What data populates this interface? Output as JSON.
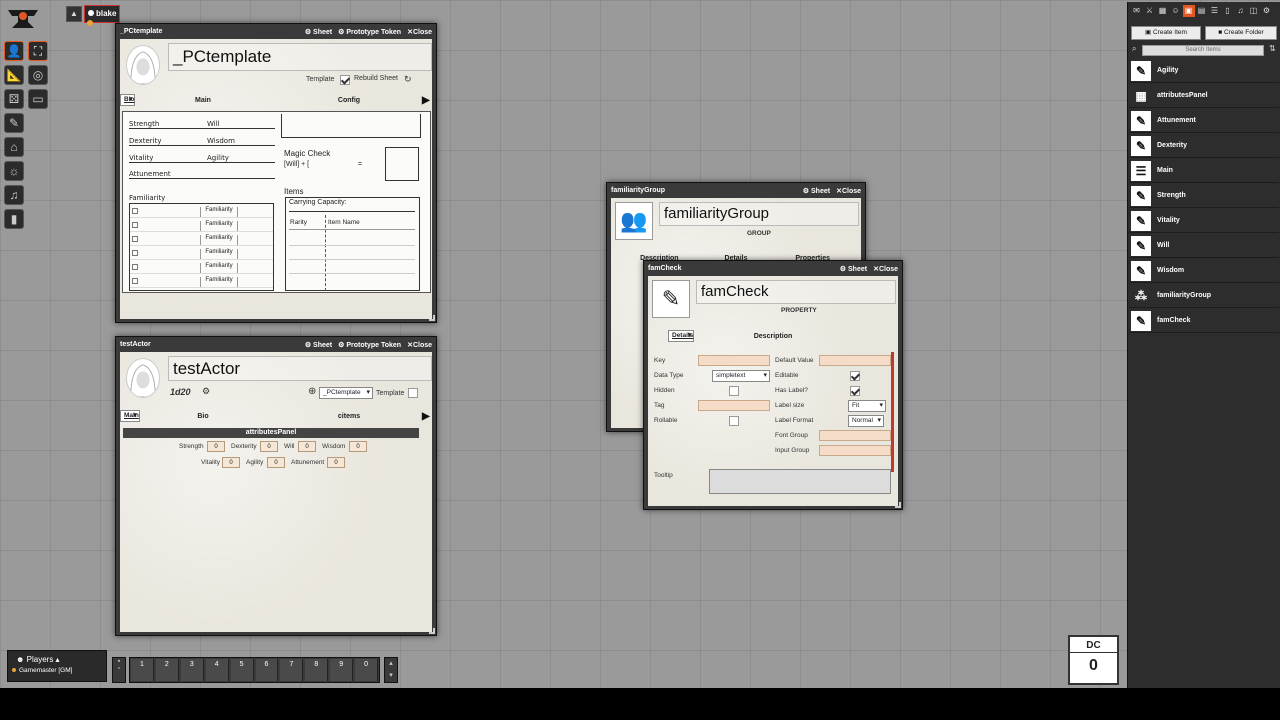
{
  "scene": {
    "tab_label": "blake",
    "toggle_icon": "caret-up"
  },
  "controls": [
    "token-icon",
    "fullscreen-icon",
    "ruler-icon",
    "target-icon",
    "dice-icon",
    "tape-icon",
    "pencil-icon",
    "temple-icon",
    "lightbulb-icon",
    "music-icon",
    "bookmark-icon"
  ],
  "windows": {
    "pctemplate": {
      "title": "_PCtemplate",
      "actions": [
        "Sheet",
        "Prototype Token",
        "Close"
      ],
      "name": "_PCtemplate",
      "template_label": "Template",
      "rebuild_label": "Rebuild Sheet",
      "tabs": [
        "Bio",
        "Main",
        "Config"
      ],
      "attrs": [
        "Strength",
        "Will",
        "Dexterity",
        "Wisdom",
        "Vitality",
        "Agility",
        "Attunement"
      ],
      "magic_check_title": "Magic Check",
      "magic_check_formula": "[Will] + [",
      "magic_check_eq": "=",
      "familiarity_title": "Familiarity",
      "familiarity_rows": [
        "Familiarity",
        "Familiarity",
        "Familiarity",
        "Familiarity",
        "Familiarity",
        "Familiarity"
      ],
      "items_title": "Items",
      "carrying_capacity": "Carrying Capacity:",
      "col_rarity": "Rarity",
      "col_item_name": "Item Name"
    },
    "testactor": {
      "title": "testActor",
      "actions": [
        "Sheet",
        "Prototype Token",
        "Close"
      ],
      "name": "testActor",
      "dice": "1d20",
      "template_select": "_PCtemplate",
      "template_label": "Template",
      "tabs": [
        "Bio",
        "Main",
        "citems"
      ],
      "panel_title": "attributesPanel",
      "row1": [
        {
          "label": "Strength",
          "value": "0"
        },
        {
          "label": "Dexterity",
          "value": "0"
        },
        {
          "label": "Will",
          "value": "0"
        },
        {
          "label": "Wisdom",
          "value": "0"
        }
      ],
      "row2": [
        {
          "label": "Vitality",
          "value": "0"
        },
        {
          "label": "Agility",
          "value": "0"
        },
        {
          "label": "Attunement",
          "value": "0"
        }
      ]
    },
    "famgroup": {
      "title": "familiarityGroup",
      "actions": [
        "Sheet",
        "Close"
      ],
      "name": "familiarityGroup",
      "kind": "GROUP",
      "tabs": [
        "Description",
        "Details",
        "Properties"
      ]
    },
    "famcheck": {
      "title": "famCheck",
      "actions": [
        "Sheet",
        "Close"
      ],
      "name": "famCheck",
      "kind": "PROPERTY",
      "tabs": [
        "Description",
        "Details"
      ],
      "fields": {
        "key": "Key",
        "data_type": "Data Type",
        "data_type_value": "simpletext",
        "hidden": "Hidden",
        "tag": "Tag",
        "rollable": "Rollable",
        "default_value": "Default Value",
        "editable": "Editable",
        "has_label": "Has Label?",
        "label_size": "Label size",
        "label_size_value": "Fit",
        "label_format": "Label Format",
        "label_format_value": "Normal",
        "font_group": "Font Group",
        "input_group": "Input Group",
        "tooltip": "Tooltip"
      }
    }
  },
  "sidebar": {
    "create_item": "Create Item",
    "create_folder": "Create Folder",
    "search_placeholder": "Search Items",
    "items": [
      {
        "label": "Agility",
        "icon": "edit-icon"
      },
      {
        "label": "attributesPanel",
        "icon": "grid-icon"
      },
      {
        "label": "Attunement",
        "icon": "edit-icon"
      },
      {
        "label": "Dexterity",
        "icon": "edit-icon"
      },
      {
        "label": "Main",
        "icon": "list-icon"
      },
      {
        "label": "Strength",
        "icon": "edit-icon"
      },
      {
        "label": "Vitality",
        "icon": "edit-icon"
      },
      {
        "label": "Will",
        "icon": "edit-icon"
      },
      {
        "label": "Wisdom",
        "icon": "edit-icon"
      },
      {
        "label": "familiarityGroup",
        "icon": "group-icon"
      },
      {
        "label": "famCheck",
        "icon": "edit-icon"
      }
    ]
  },
  "players": {
    "title": "Players",
    "entry": "Gamemaster [GM]"
  },
  "hotbar": {
    "slots": [
      "1",
      "2",
      "3",
      "4",
      "5",
      "6",
      "7",
      "8",
      "9",
      "0"
    ]
  },
  "dc": {
    "label": "DC",
    "value": "0"
  },
  "colors": {
    "accent": "#e25822",
    "window_bg": "#3a3a3a",
    "sheet_bg": "#e9e6dd",
    "input_bg": "#f4dcc8"
  }
}
